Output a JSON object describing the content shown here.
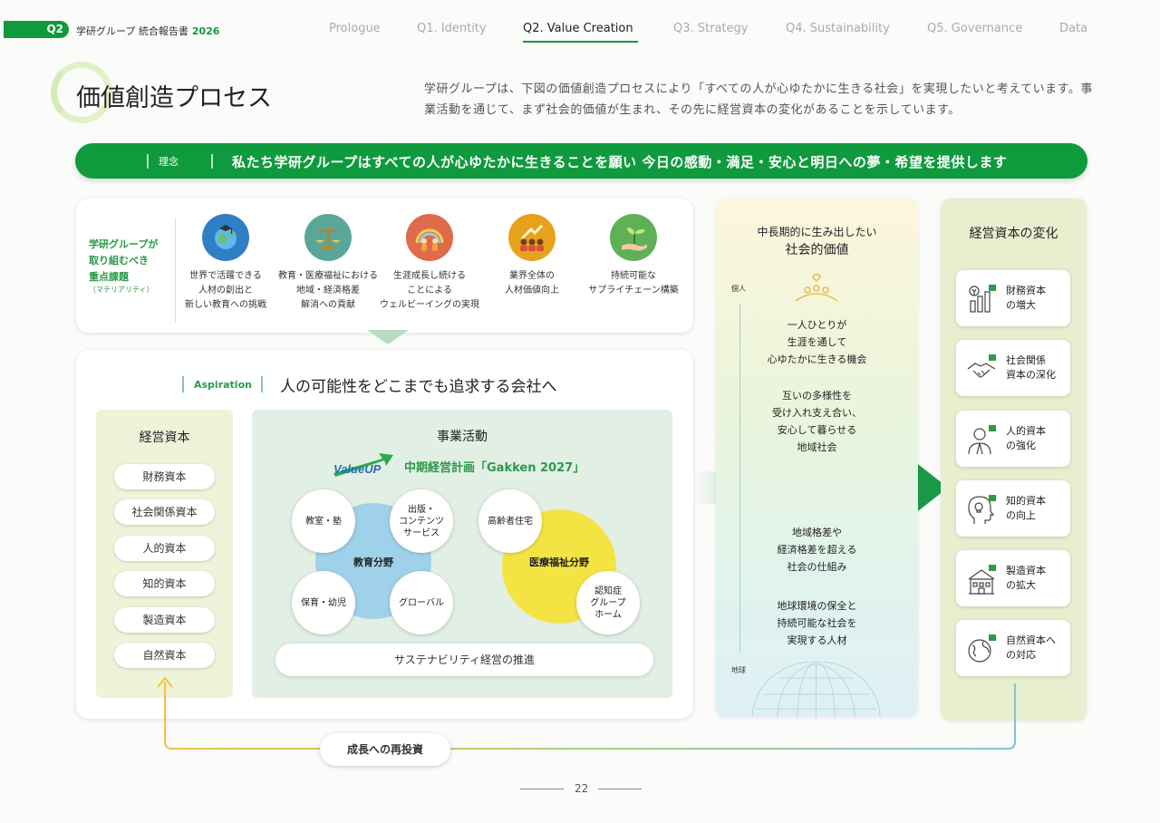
{
  "header": {
    "section_badge": "Q2",
    "brand": "学研グループ 統合報告書",
    "year": "2026",
    "nav": [
      "Prologue",
      "Q1. Identity",
      "Q2. Value Creation",
      "Q3. Strategy",
      "Q4. Sustainability",
      "Q5. Governance",
      "Data"
    ],
    "active_nav": "Q2. Value Creation"
  },
  "page": {
    "title": "価値創造プロセス",
    "intro": "学研グループは、下図の価値創造プロセスにより「すべての人が心ゆたかに生きる社会」を実現したいと考えています。事業活動を通じて、まず社会的価値が生まれ、その先に経営資本の変化があることを示しています。",
    "page_number": "22"
  },
  "philosophy": {
    "label": "理念",
    "text": "私たち学研グループはすべての人が心ゆたかに生きることを願い 今日の感動・満足・安心と明日への夢・希望を提供します"
  },
  "materiality": {
    "heading_lines": [
      "学研グループが",
      "取り組むべき",
      "重点課題"
    ],
    "sub": "（マテリアリティ）",
    "items": [
      {
        "lines": [
          "世界で活躍できる",
          "人材の創出と",
          "新しい教育への挑戦"
        ],
        "icon": "globe-icon",
        "color": "#2f7fc6"
      },
      {
        "lines": [
          "教育・医療福祉における",
          "地域・経済格差",
          "解消への貢献"
        ],
        "icon": "scales-icon",
        "color": "#5aa79a"
      },
      {
        "lines": [
          "生涯成長し続ける",
          "ことによる",
          "ウェルビーイングの実現"
        ],
        "icon": "rainbow-family-icon",
        "color": "#e06a4c"
      },
      {
        "lines": [
          "業界全体の",
          "人材価値向上"
        ],
        "icon": "people-growth-icon",
        "color": "#e7a21d"
      },
      {
        "lines": [
          "持続可能な",
          "サプライチェーン構築"
        ],
        "icon": "sprout-hand-icon",
        "color": "#5fb157"
      }
    ]
  },
  "aspiration": {
    "label": "Aspiration",
    "text": "人の可能性をどこまでも追求する会社へ"
  },
  "capitals": {
    "title": "経営資本",
    "items": [
      "財務資本",
      "社会関係資本",
      "人的資本",
      "知的資本",
      "製造資本",
      "自然資本"
    ]
  },
  "business": {
    "title": "事業活動",
    "logo_text": "ValueUP",
    "plan": "中期経営計画「Gakken 2027」",
    "education": {
      "label": "教育分野",
      "items": [
        "教室・塾",
        "出版・\nコンテンツ\nサービス",
        "保育・幼児",
        "グローバル"
      ]
    },
    "medical": {
      "label": "医療福祉分野",
      "items": [
        "高齢者住宅",
        "認知症\nグループ\nホーム"
      ]
    },
    "sustainability": "サステナビリティ経営の推進"
  },
  "social_value": {
    "title_line1": "中長期的に生み出したい",
    "title_line2": "社会的価値",
    "axis_top": "個人",
    "axis_bottom": "地球",
    "blocks": [
      [
        "一人ひとりが",
        "生涯を通して",
        "心ゆたかに生きる機会"
      ],
      [
        "互いの多様性を",
        "受け入れ支え合い、",
        "安心して暮らせる",
        "地域社会"
      ],
      [
        "地域格差や",
        "経済格差を超える",
        "社会の仕組み"
      ],
      [
        "地球環境の保全と",
        "持続可能な社会を",
        "実現する人材"
      ]
    ]
  },
  "capital_change": {
    "title": "経営資本の変化",
    "items": [
      {
        "lines": [
          "財務資本",
          "の増大"
        ],
        "icon": "finance-chart-icon"
      },
      {
        "lines": [
          "社会関係",
          "資本の深化"
        ],
        "icon": "handshake-icon"
      },
      {
        "lines": [
          "人的資本",
          "の強化"
        ],
        "icon": "person-icon"
      },
      {
        "lines": [
          "知的資本",
          "の向上"
        ],
        "icon": "head-bulb-icon"
      },
      {
        "lines": [
          "製造資本",
          "の拡大"
        ],
        "icon": "building-icon"
      },
      {
        "lines": [
          "自然資本へ",
          "の対応"
        ],
        "icon": "earth-leaf-icon"
      }
    ]
  },
  "reinvest": "成長への再投資"
}
